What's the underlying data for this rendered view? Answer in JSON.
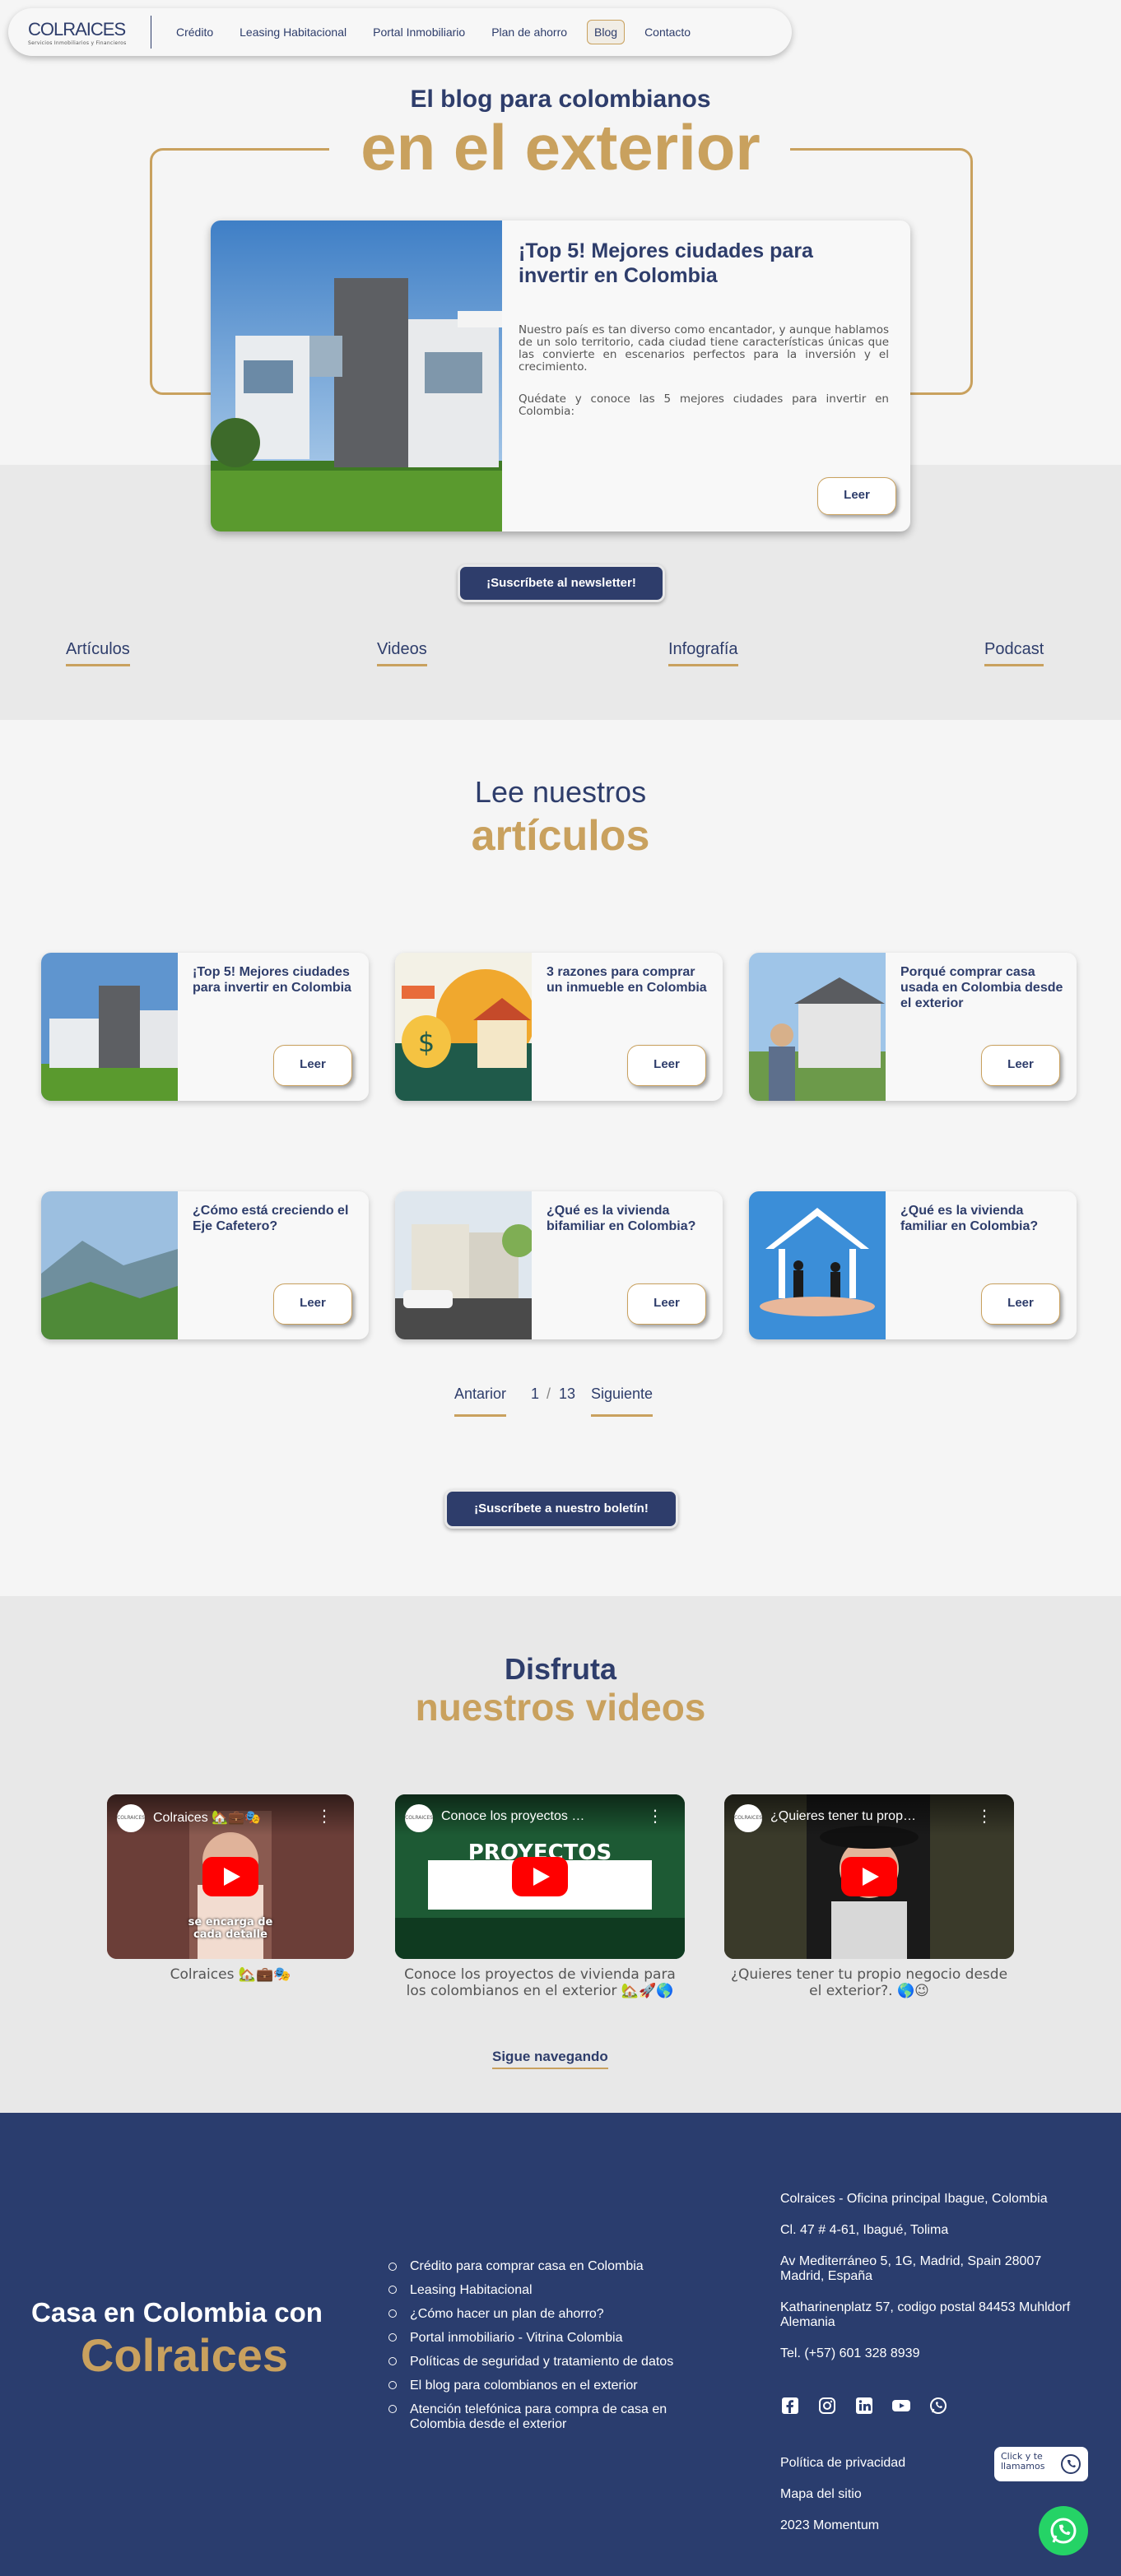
{
  "nav": {
    "logo": "COLRAICES",
    "logo_tagline": "Servicios Inmobiliarios y Financieros",
    "items": [
      "Crédito",
      "Leasing Habitacional",
      "Portal Inmobiliario",
      "Plan de ahorro",
      "Blog",
      "Contacto"
    ],
    "active": "Blog"
  },
  "hero": {
    "subtitle": "El blog para colombianos",
    "title": "en el exterior",
    "featured": {
      "title": "¡Top 5! Mejores ciudades para invertir en Colombia",
      "paragraph1": "Nuestro país es tan diverso como encantador, y aunque hablamos de un solo territorio, cada ciudad tiene características únicas que las convierte en escenarios perfectos para la inversión y el crecimiento.",
      "paragraph2": "Quédate y conoce las 5 mejores ciudades para invertir en Colombia:",
      "button": "Leer"
    },
    "newsletter_button": "¡Suscríbete al newsletter!"
  },
  "categories": [
    "Artículos",
    "Videos",
    "Infografía",
    "Podcast"
  ],
  "articles": {
    "heading_line1": "Lee nuestros",
    "heading_line2": "artículos",
    "cards": [
      {
        "title": "¡Top 5! Mejores ciudades para invertir en Colombia",
        "button": "Leer"
      },
      {
        "title": "3 razones para comprar un inmueble en Colombia",
        "button": "Leer"
      },
      {
        "title": "Porqué comprar casa usada en Colombia desde el exterior",
        "button": "Leer"
      },
      {
        "title": "¿Cómo está creciendo el Eje Cafetero?",
        "button": "Leer"
      },
      {
        "title": "¿Qué es la vivienda bifamiliar en Colombia?",
        "button": "Leer"
      },
      {
        "title": "¿Qué es la vivienda familiar en Colombia?",
        "button": "Leer"
      }
    ],
    "pagination": {
      "prev": "Antarior",
      "current": "1",
      "separator": "/",
      "total": "13",
      "next": "Siguiente"
    },
    "bulletin_button": "¡Suscríbete a nuestro boletín!"
  },
  "videos": {
    "heading_line1": "Disfruta",
    "heading_line2": "nuestros videos",
    "items": [
      {
        "title": "Colraices 🏡💼🎭",
        "overlay": "se encarga de cada detalle",
        "caption": "Colraices 🏡💼🎭"
      },
      {
        "title": "Conoce los proyectos de vi...",
        "overlay": "PROYECTOS EN VENTA",
        "caption": "Conoce los proyectos de vivienda para los colombianos en el exterior 🏡🚀🌎"
      },
      {
        "title": "¿Quieres tener tu propio ne...",
        "overlay": "",
        "caption": "¿Quieres tener tu propio negocio desde el exterior?. 🌎😉"
      }
    ],
    "channel_avatar": "COLRAICES",
    "more_link": "Sigue navegando"
  },
  "footer": {
    "brand_line1": "Casa en Colombia con",
    "brand_line2": "Colraices",
    "links": [
      "Crédito para comprar casa en Colombia",
      "Leasing Habitacional",
      "¿Cómo hacer un plan de ahorro?",
      "Portal inmobiliario - Vitrina Colombia",
      "Políticas de seguridad y tratamiento de datos",
      "El blog para colombianos en el exterior",
      "Atención telefónica para compra de casa en Colombia desde el exterior"
    ],
    "office_title": "Colraices - Oficina principal Ibague, Colombia",
    "address1": "Cl. 47 # 4-61, Ibagué, Tolima",
    "address2": "Av Mediterráneo 5, 1G, Madrid, Spain 28007 Madrid, España",
    "address3": "Katharinenplatz 57, codigo postal 84453 Muhldorf Alemania",
    "phone": "Tel. (+57) 601 328 8939",
    "socials": [
      "facebook-icon",
      "instagram-icon",
      "linkedin-icon",
      "youtube-icon",
      "whatsapp-icon"
    ],
    "privacy": "Política de privacidad",
    "sitemap": "Mapa del sitio",
    "credit": "2023 Momentum",
    "clicky": "Click y te llamamos"
  }
}
